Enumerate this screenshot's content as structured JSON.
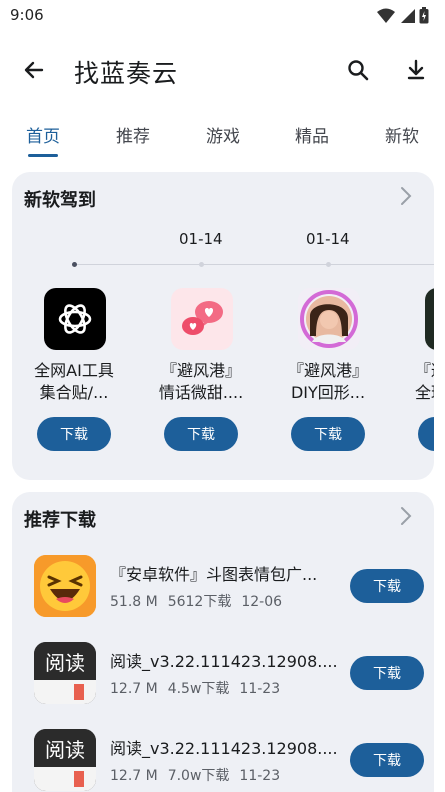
{
  "status_bar": {
    "time": "9:06"
  },
  "app_bar": {
    "title": "找蓝奏云"
  },
  "tabs": [
    {
      "label": "首页"
    },
    {
      "label": "推荐"
    },
    {
      "label": "游戏"
    },
    {
      "label": "精品"
    },
    {
      "label": "新软"
    }
  ],
  "new_software": {
    "title": "新软驾到",
    "dates": [
      "01-14",
      "01-14"
    ],
    "apps": [
      {
        "name_line1": "全网AI工具",
        "name_line2": "集合贴/...",
        "button": "下载",
        "icon": "openai-logo-icon"
      },
      {
        "name_line1": "『避风港』",
        "name_line2": "情话微甜....",
        "button": "下载",
        "icon": "chat-hearts-icon"
      },
      {
        "name_line1": "『避风港』",
        "name_line2": "DIY回形...",
        "button": "下载",
        "icon": "avatar-frame-icon"
      },
      {
        "name_line1": "『避",
        "name_line2": "全球",
        "button": "下载",
        "icon": "green-app-icon"
      }
    ]
  },
  "recommended": {
    "title": "推荐下载",
    "items": [
      {
        "name": "『安卓软件』斗图表情包广...",
        "size": "51.8 M",
        "downloads": "5612下载",
        "date": "12-06",
        "button": "下载",
        "icon": "laughing-emoji-icon"
      },
      {
        "name": "阅读_v3.22.111423.12908....",
        "size": "12.7 M",
        "downloads": "4.5w下载",
        "date": "11-23",
        "button": "下载",
        "icon": "read-app-icon",
        "icon_text": "阅读"
      },
      {
        "name": "阅读_v3.22.111423.12908....",
        "size": "12.7 M",
        "downloads": "7.0w下载",
        "date": "11-23",
        "button": "下载",
        "icon": "read-app-icon",
        "icon_text": "阅读"
      }
    ]
  },
  "colors": {
    "accent": "#1d5f9a",
    "card_bg": "#eef0f5"
  }
}
